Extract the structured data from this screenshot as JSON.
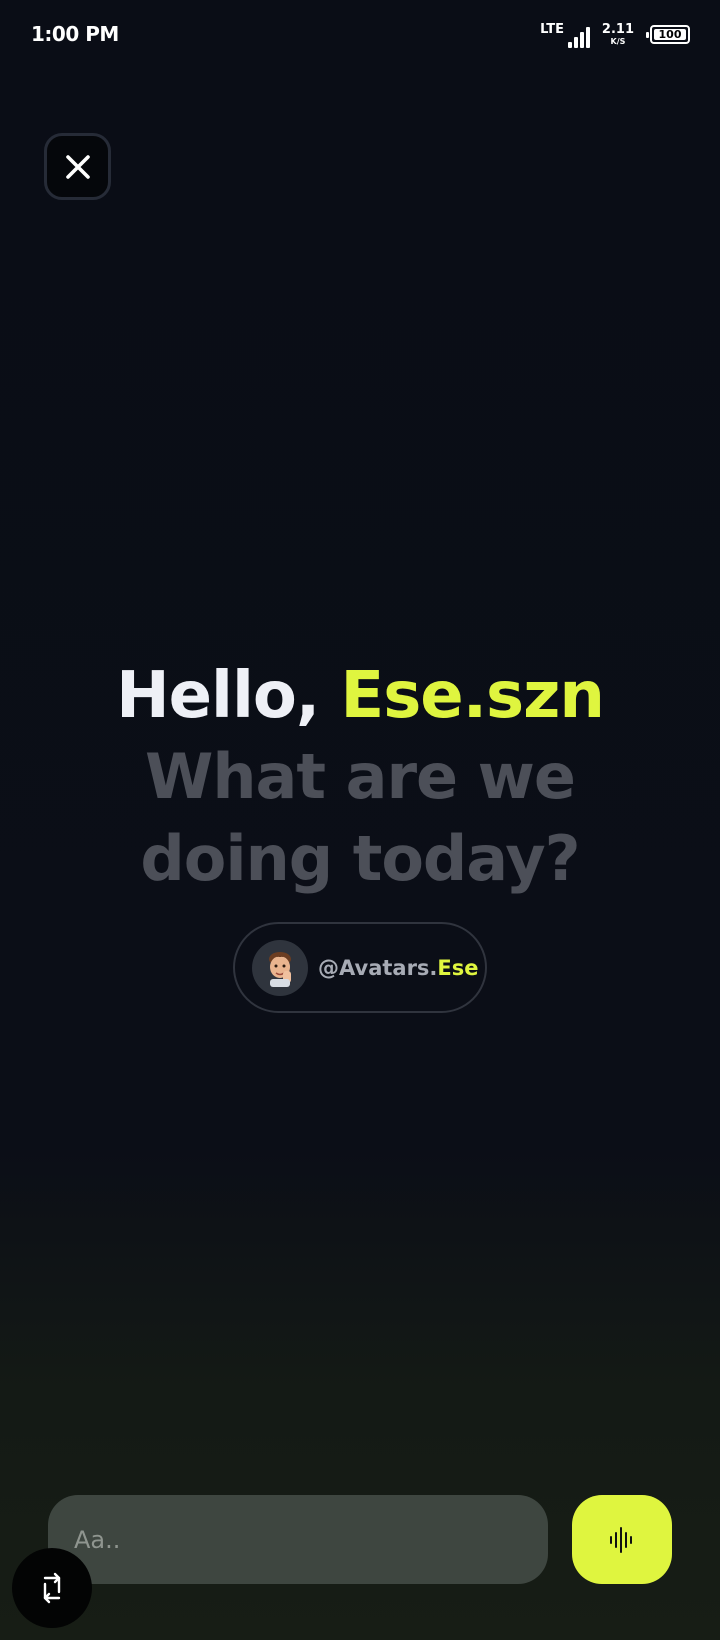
{
  "status_bar": {
    "time": "1:00 PM",
    "network": "LTE",
    "speed_value": "2.11",
    "speed_unit": "K/S",
    "battery": "100"
  },
  "header": {
    "close_icon": "close-icon"
  },
  "greeting": {
    "hello": "Hello, ",
    "name": "Ese.szn",
    "subtitle": "What are we doing today?"
  },
  "handle": {
    "prefix": "@Avatars.",
    "suffix": "Ese",
    "avatar_icon": "memoji-avatar"
  },
  "composer": {
    "placeholder": "Aa..",
    "voice_icon": "voice-waveform-icon",
    "switch_icon": "switch-icon"
  },
  "colors": {
    "accent": "#dff53f",
    "background": "#0a0d16",
    "input_bg": "#3e4640",
    "muted_text": "#4c4f58"
  }
}
